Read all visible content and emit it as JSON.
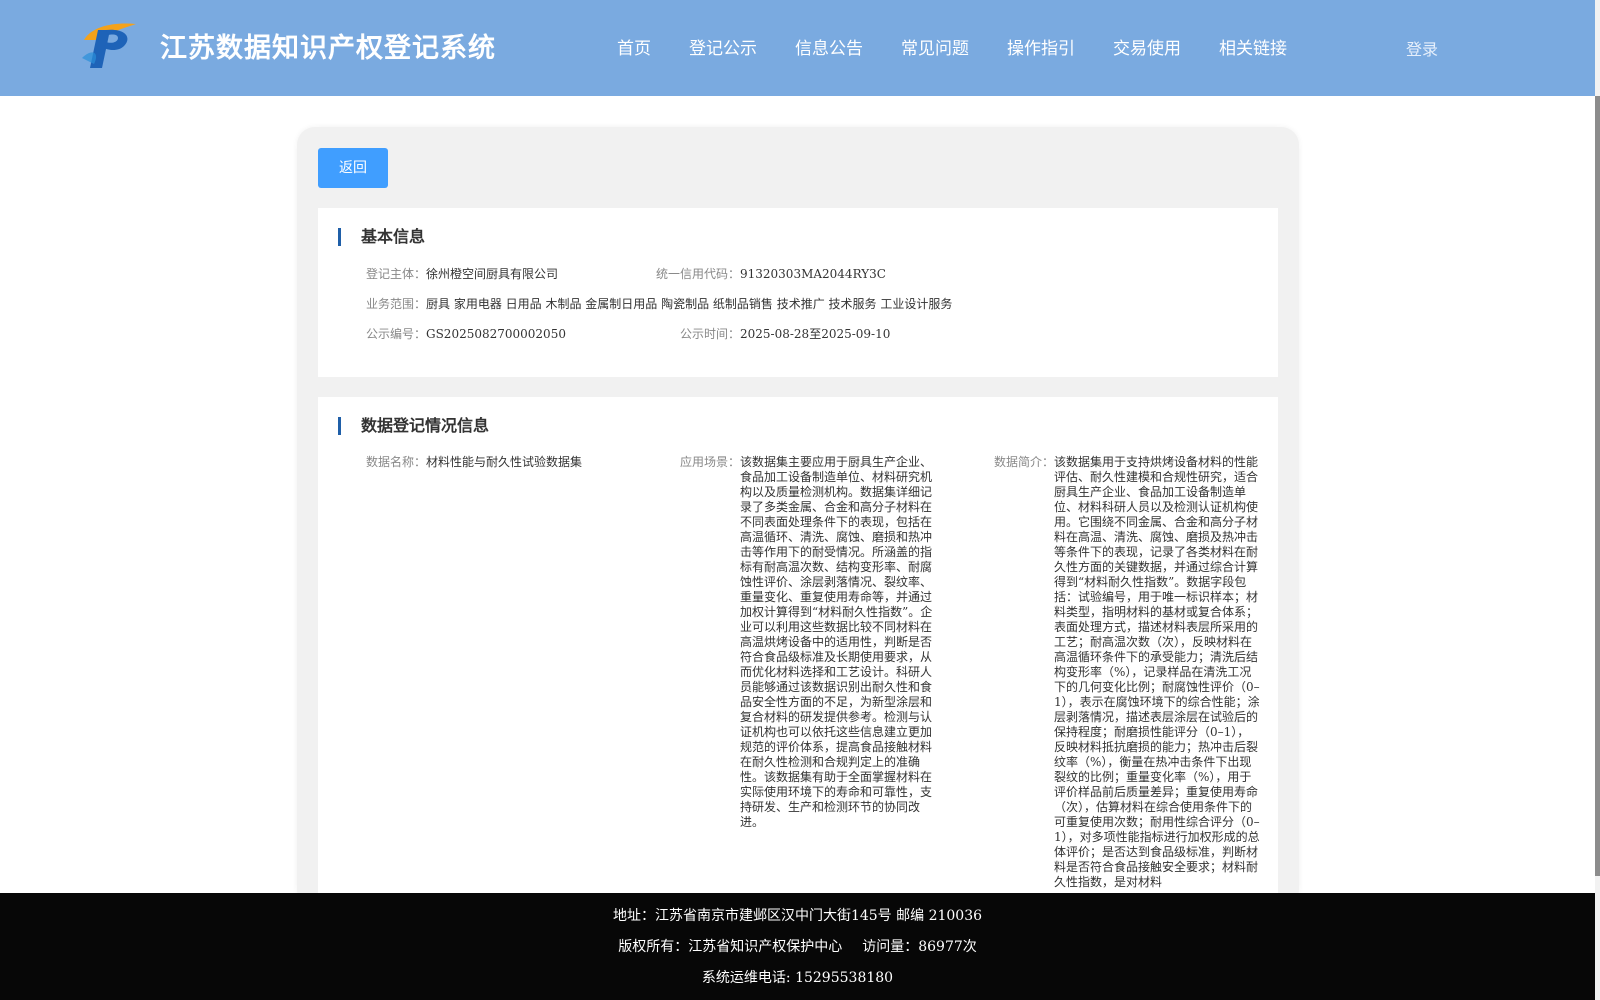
{
  "header": {
    "title": "江苏数据知识产权登记系统",
    "nav": [
      "首页",
      "登记公示",
      "信息公告",
      "常见问题",
      "操作指引",
      "交易使用",
      "相关链接"
    ],
    "login": "登录"
  },
  "back_button": "返回",
  "basic": {
    "title": "基本信息",
    "subject_label": "登记主体：",
    "subject": "徐州橙空间厨具有限公司",
    "credit_label": "统一信用代码：",
    "credit": "91320303MA2044RY3C",
    "scope_label": "业务范围：",
    "scope": "厨具 家用电器 日用品 木制品 金属制日用品 陶瓷制品 纸制品销售 技术推广 技术服务 工业设计服务",
    "notice_no_label": "公示编号：",
    "notice_no": "GS2025082700002050",
    "notice_time_label": "公示时间：",
    "notice_time": "2025-08-28至2025-09-10"
  },
  "registration": {
    "title": "数据登记情况信息",
    "name_label": "数据名称：",
    "name": "材料性能与耐久性试验数据集",
    "scene_label": "应用场景：",
    "scene": "该数据集主要应用于厨具生产企业、食品加工设备制造单位、材料研究机构以及质量检测机构。数据集详细记录了多类金属、合金和高分子材料在不同表面处理条件下的表现，包括在高温循环、清洗、腐蚀、磨损和热冲击等作用下的耐受情况。所涵盖的指标有耐高温次数、结构变形率、耐腐蚀性评价、涂层剥落情况、裂纹率、重量变化、重复使用寿命等，并通过加权计算得到“材料耐久性指数”。企业可以利用这些数据比较不同材料在高温烘烤设备中的适用性，判断是否符合食品级标准及长期使用要求，从而优化材料选择和工艺设计。科研人员能够通过该数据识别出耐久性和食品安全性方面的不足，为新型涂层和复合材料的研发提供参考。检测与认证机构也可以依托这些信息建立更加规范的评价体系，提高食品接触材料在耐久性检测和合规判定上的准确性。该数据集有助于全面掌握材料在实际使用环境下的寿命和可靠性，支持研发、生产和检测环节的协同改进。",
    "intro_label": "数据简介：",
    "intro": "该数据集用于支持烘烤设备材料的性能评估、耐久性建模和合规性研究，适合厨具生产企业、食品加工设备制造单位、材料科研人员以及检测认证机构使用。它围绕不同金属、合金和高分子材料在高温、清洗、腐蚀、磨损及热冲击等条件下的表现，记录了各类材料在耐久性方面的关键数据，并通过综合计算得到“材料耐久性指数”。数据字段包括：试验编号，用于唯一标识样本；材料类型，指明材料的基材或复合体系；表面处理方式，描述材料表层所采用的工艺；耐高温次数（次），反映材料在高温循环条件下的承受能力；清洗后结构变形率（%），记录样品在清洗工况下的几何变化比例；耐腐蚀性评价（0–1），表示在腐蚀环境下的综合性能；涂层剥落情况，描述表层涂层在试验后的保持程度；耐磨损性能评分（0–1），反映材料抵抗磨损的能力；热冲击后裂纹率（%），衡量在热冲击条件下出现裂纹的比例；重量变化率（%），用于评价样品前后质量差异；重复使用寿命（次），估算材料在综合使用条件下的可重复使用次数；耐用性综合评分（0–1），对多项性能指标进行加权形成的总体评价；是否达到食品级标准，判断材料是否符合食品接触安全要求；材料耐久性指数，是对材料"
  },
  "footer": {
    "address": "地址：江苏省南京市建邺区汉中门大街145号 邮编 210036",
    "copyright": "版权所有：江苏省知识产权保护中心",
    "visits": "访问量：86977次",
    "phone": "系统运维电话: 15295538180"
  }
}
